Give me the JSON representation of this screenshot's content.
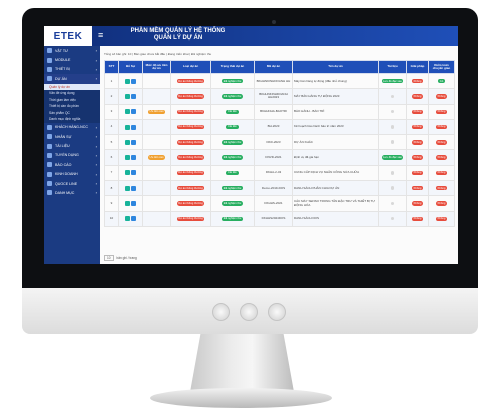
{
  "app": {
    "logo": "ETEK",
    "title_line1": "PHẦN MỀM QUẢN LÝ HỆ THỐNG",
    "title_line2": "QUẢN LÝ DỰ ÁN"
  },
  "sidebar": {
    "items_before": [
      {
        "label": "VẬT TƯ",
        "icon": "box-icon"
      },
      {
        "label": "MODULE",
        "icon": "module-icon"
      },
      {
        "label": "THIẾT BỊ",
        "icon": "device-icon"
      }
    ],
    "active": {
      "label": "DỰ ÁN",
      "icon": "project-icon"
    },
    "sub_items": [
      {
        "label": "Quản lý dự án"
      },
      {
        "label": "Văn đề ứng dụng"
      },
      {
        "label": "Thời gian làm việc"
      },
      {
        "label": "Thiết bị cần đo phần"
      },
      {
        "label": "Sản phẩm QC"
      },
      {
        "label": "Danh mục định nghĩa"
      }
    ],
    "items_after": [
      {
        "label": "KHÁCH HÀNG-NCC",
        "icon": "customer-icon"
      },
      {
        "label": "NHÂN SỰ",
        "icon": "people-icon"
      },
      {
        "label": "TÀI LIỆU",
        "icon": "document-icon"
      },
      {
        "label": "TUYỂN DỤNG",
        "icon": "recruit-icon"
      },
      {
        "label": "BÁO CÁO",
        "icon": "report-icon"
      },
      {
        "label": "KINH DOANH",
        "icon": "business-icon"
      },
      {
        "label": "QUOCE LINE",
        "icon": "quote-icon"
      },
      {
        "label": "DANH MỤC",
        "icon": "catalog-icon"
      }
    ]
  },
  "main": {
    "note": "Tổng số bản ghi: 10 | Bàn giao chưa bắt đầu | Đang triển khai | Đã nghiệm thu",
    "columns": [
      "STT",
      "Bổ Sự",
      "Mức độ ưu tiên dự án",
      "Loại dự án",
      "Trạng thái dự án",
      "Mã dự án",
      "Tên dự án",
      "Tài liệu",
      "Giải pháp",
      "Kiểm toán chuyển giao"
    ],
    "rows": [
      {
        "stt": "1",
        "priority": "",
        "type": "Dự án thông thường",
        "status": "Đã nghiệm thu",
        "code": "BKHHNKINHDOANH HH",
        "name": "Máy bán hàng tự động (đầu nhỏ chung)",
        "doc": "Lưu đo đạc sau",
        "solution": "Không",
        "handover": "Có"
      },
      {
        "stt": "2",
        "priority": "",
        "type": "Dự án thông thường",
        "status": "Đã nghiệm thu",
        "code": "BKHHNKINHDOANH HH2023",
        "name": "MÁY BÁN HÀNG TỰ ĐỘNG 2023",
        "doc": "",
        "solution": "Không",
        "handover": "Không"
      },
      {
        "stt": "3",
        "priority": "Ưu tiên cao",
        "type": "Dự án thông thường",
        "status": "Cải tiến",
        "code": "BKHHNHA-BAOTRI",
        "name": "BẢO HÀNH - BẢO TRÌ",
        "doc": "",
        "solution": "Không",
        "handover": "Không"
      },
      {
        "stt": "4",
        "priority": "",
        "type": "Dự án thông thường",
        "status": "Cải tiến",
        "code": "BH-2023",
        "name": "Kế hoạch bảo hành bảo trì năm 2023",
        "doc": "",
        "solution": "Không",
        "handover": "Không"
      },
      {
        "stt": "5",
        "priority": "",
        "type": "Dự án thông thường",
        "status": "Đã nghiệm thu",
        "code": "DKD-2023",
        "name": "DỰ ÁN KHÁC",
        "doc": "",
        "solution": "Không",
        "handover": "Không"
      },
      {
        "stt": "6",
        "priority": "Ưu tiên cao",
        "type": "Dự án thông thường",
        "status": "Đã nghiệm thu",
        "code": "DNVD-2021",
        "name": "Định vụ đã gia hạn",
        "doc": "Lưu đo đạc sau",
        "solution": "Không",
        "handover": "Không"
      },
      {
        "stt": "7",
        "priority": "",
        "type": "Dự án thông thường",
        "status": "Cải tiến",
        "code": "DKHA-2-43",
        "name": "CUNG CẤP DỊCH VỤ NHÂN CÔNG SỬA CHỮA",
        "doc": "",
        "solution": "Không",
        "handover": "Không"
      },
      {
        "stt": "8",
        "priority": "",
        "type": "Dự án thông thường",
        "status": "Đã nghiệm thu",
        "code": "Demo-2019-DOS",
        "name": "DANH SÁCH PHÂN CHIA DỰ ÁN",
        "doc": "",
        "solution": "Không",
        "handover": "Không"
      },
      {
        "stt": "9",
        "priority": "",
        "type": "Dự án thông thường",
        "status": "Đã nghiệm thu",
        "code": "DKHHS-2021",
        "name": "CÁC MẢY SENSO TRONG TÂN ĐẶC TRƯ VÀ THIẾT BỊ TỰ ĐỘNG HÓA",
        "doc": "",
        "solution": "Không",
        "handover": "Không"
      },
      {
        "stt": "10",
        "priority": "",
        "type": "Dự án thông thường",
        "status": "Đã nghiệm thu",
        "code": "DKHHS2024DOS",
        "name": "DANH SÁCH DOS",
        "doc": "",
        "solution": "Không",
        "handover": "Không"
      }
    ],
    "pager": {
      "size": "10",
      "label": "bản ghi / trang"
    }
  },
  "colors": {
    "topbar": "#1f4fb8",
    "sidebar": "#1b3b82",
    "red_pill": "#e74c3c",
    "green_pill": "#27ae60",
    "orange_pill": "#f0a030",
    "teal_pill": "#17b39a"
  }
}
